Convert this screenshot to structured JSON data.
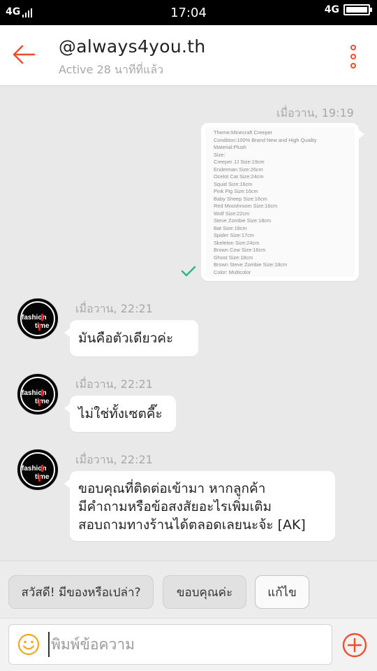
{
  "status_bar": {
    "network_left": "4G",
    "time": "17:04",
    "network_right": "4G"
  },
  "header": {
    "title": "@always4you.th",
    "subtitle": "Active 28 นาทีที่แล้ว",
    "accent_color": "#ee4d2d"
  },
  "messages": [
    {
      "side": "right",
      "timestamp": "เมื่อวาน, 19:19",
      "type": "image",
      "image_text": [
        "Theme:Minecraft Creeper",
        "Condition:100% Brand New and High Quality",
        "Material:Plush",
        "Size:",
        "Creeper JJ Size:19cm",
        "Enderman Size:26cm",
        "Ocelot Cat Size:24cm",
        "Squid Size:16cm",
        "Pink Pig Size:16cm",
        "Baby Sheep Size:16cm",
        "Red Mooshroom Size:16cm",
        "Wolf Size:22cm",
        "Steve Zombie Size:18cm",
        "Bat Size:18cm",
        "Spider Size:17cm",
        "Skeleton Size:24cm",
        "Brown Cow Size:16cm",
        "Ghost Size:18cm",
        "Brown Steve Zombie Size:18cm",
        "Color: Multicolor"
      ],
      "status": "read-check-icon"
    },
    {
      "side": "left",
      "timestamp": "เมื่อวาน, 22:21",
      "text": "มันคือตัวเดียวค่ะ"
    },
    {
      "side": "left",
      "timestamp": "เมื่อวาน, 22:21",
      "text": "ไม่ใช่ทั้งเซตคี๊ะ"
    },
    {
      "side": "left",
      "timestamp": "เมื่อวาน, 22:21",
      "lines": [
        "ขอบคุณที่ติดต่อเข้ามา หากลูกค้า",
        "มีคำถามหรือข้อสงสัยอะไรเพิ่มเติม",
        "สอบถามทางร้านได้ตลอดเลยนะจ้ะ [AK]"
      ]
    }
  ],
  "avatar": {
    "brand_line1": "fashion",
    "brand_line2": "time"
  },
  "quick_replies": [
    "สวัสดี! มีของหรือเปล่า?",
    "ขอบคุณค่ะ",
    "แก้ไข"
  ],
  "composer": {
    "placeholder": "พิมพ์ข้อความ",
    "emoji_icon": "smiley-icon",
    "add_icon": "plus-circle-icon"
  },
  "colors": {
    "accent": "#ee4d2d",
    "check": "#26b58c",
    "emoji": "#f5a623",
    "chat_bg": "#e9e9e9"
  }
}
